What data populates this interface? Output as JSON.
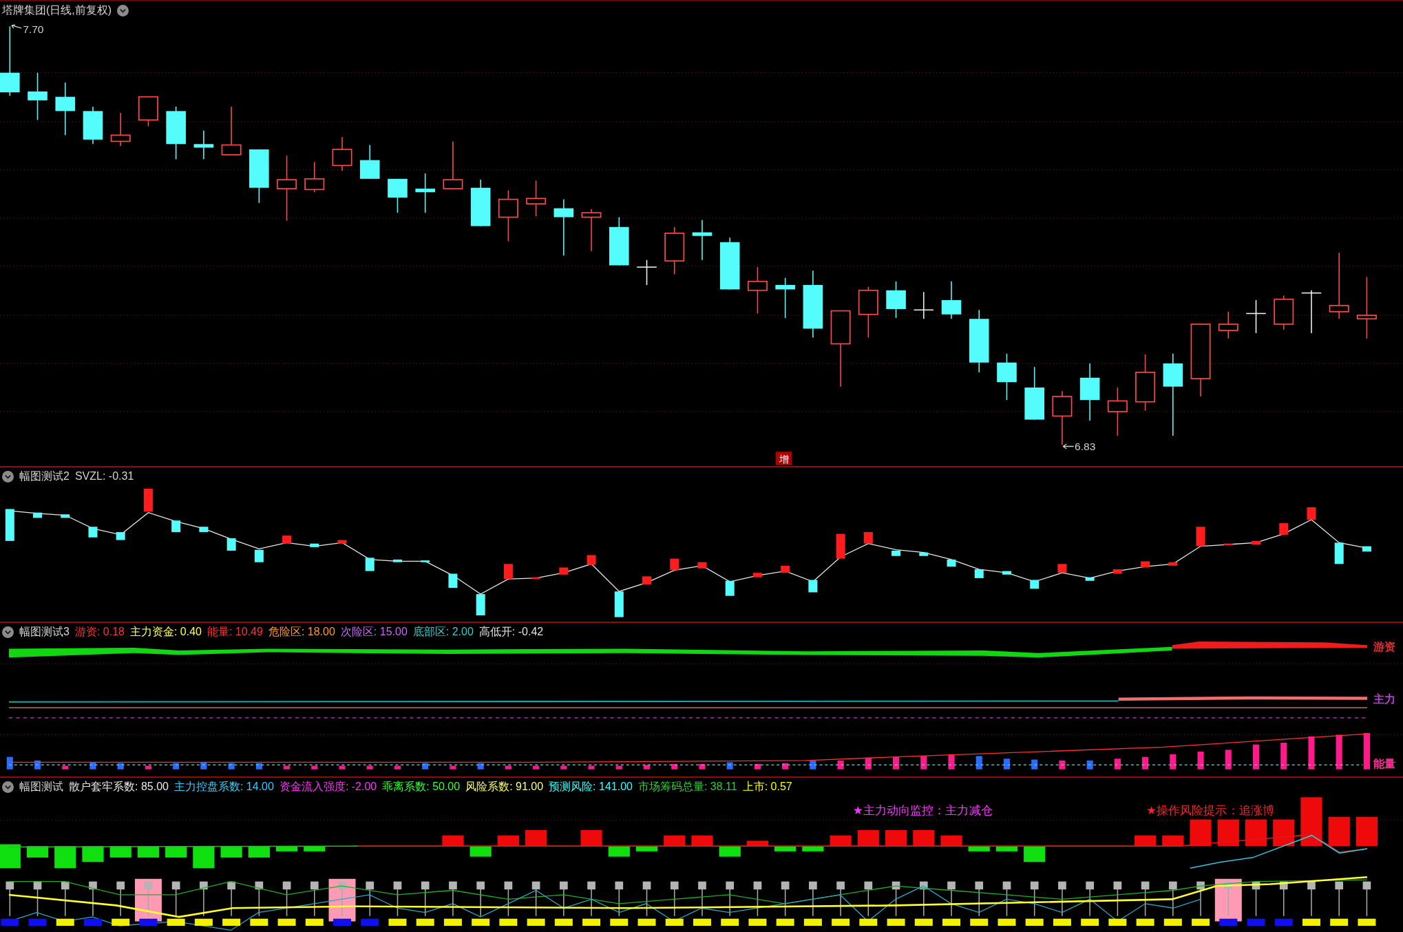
{
  "main_chart": {
    "title": "塔牌集团(日线,前复权)",
    "high_label": "7.70",
    "low_label": "6.83",
    "badge": "增"
  },
  "panels": [
    {
      "kind": "svzl",
      "title": "幅图测试2",
      "indicators": [
        {
          "text": "SVZL: -0.31"
        }
      ]
    },
    {
      "kind": "capital",
      "title": "幅图测试3",
      "indicators": [
        {
          "text": "游资: 0.18",
          "color": "#ff3333"
        },
        {
          "text": "主力资金: 0.40",
          "color": "#ffff55"
        },
        {
          "text": "能量: 10.49",
          "color": "#ff3333"
        },
        {
          "text": "危险区: 18.00",
          "color": "#ff9933"
        },
        {
          "text": "次险区: 15.00",
          "color": "#cc66ff"
        },
        {
          "text": "底部区: 2.00",
          "color": "#33cccc"
        },
        {
          "text": "高低开: -0.42",
          "color": "#e0e0e0"
        }
      ],
      "line_labels": [
        {
          "text": "游资",
          "color": "#e83030"
        },
        {
          "text": "主力",
          "color": "#c040e0"
        },
        {
          "text": "能量",
          "color": "#ff3399"
        }
      ]
    },
    {
      "kind": "risk",
      "title": "幅图测试",
      "indicators": [
        {
          "text": "散户套牢系数: 85.00",
          "color": "#e8e8e8"
        },
        {
          "text": "主力控盘系数: 14.00",
          "color": "#33ccff"
        },
        {
          "text": "资金流入强度: -2.00",
          "color": "#ff33ff"
        },
        {
          "text": "乖离系数: 50.00",
          "color": "#33ff33"
        },
        {
          "text": "风险系数: 91.00",
          "color": "#ffff66"
        },
        {
          "text": "预测风险: 141.00",
          "color": "#33ffff"
        },
        {
          "text": "市场筹码总量: 38.11",
          "color": "#33cc33"
        },
        {
          "text": "上市: 0.57",
          "color": "#ffff00"
        }
      ],
      "signals": [
        {
          "text": "★主力动向监控：主力减仓",
          "color": "#ff33ff"
        },
        {
          "text": "★操作风险提示：追涨博",
          "color": "#ff2020"
        }
      ]
    }
  ]
}
